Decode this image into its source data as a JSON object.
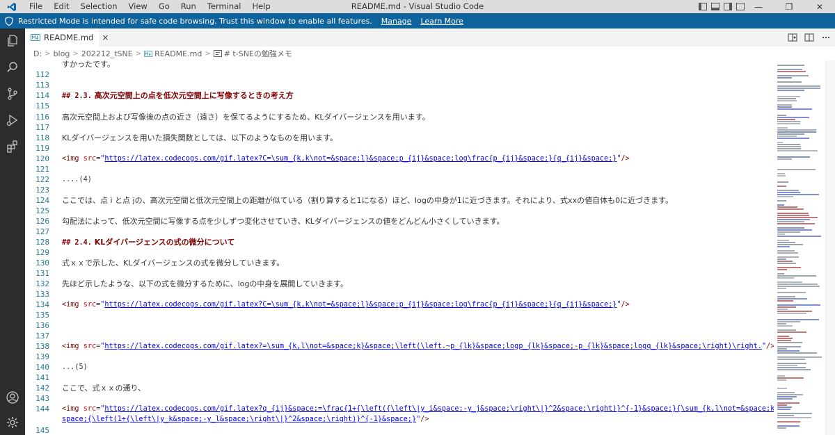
{
  "window": {
    "title": "README.md - Visual Studio Code",
    "menu": [
      "File",
      "Edit",
      "Selection",
      "View",
      "Go",
      "Run",
      "Terminal",
      "Help"
    ],
    "controls": {
      "minimize": "—",
      "restore": "❐",
      "close": "✕"
    }
  },
  "banner": {
    "message": "Restricted Mode is intended for safe code browsing. Trust this window to enable all features.",
    "manage": "Manage",
    "learn_more": "Learn More",
    "color": "#0e639c"
  },
  "activity_bar": {
    "items": [
      {
        "name": "explorer-icon"
      },
      {
        "name": "search-icon"
      },
      {
        "name": "source-control-icon"
      },
      {
        "name": "run-debug-icon"
      },
      {
        "name": "extensions-icon"
      },
      {
        "name": "accounts-icon"
      },
      {
        "name": "manage-gear-icon"
      }
    ]
  },
  "tab": {
    "label": "README.md",
    "close": "×"
  },
  "breadcrumb": {
    "parts": [
      "D:",
      "blog",
      "202212_tSNE",
      "README.md",
      "# t-SNEの勉強メモ"
    ]
  },
  "editor": {
    "top_partial": "すかったです。",
    "lines": {
      "n112": "112",
      "n113": "113",
      "n114": "114",
      "n115": "115",
      "n116": "116",
      "n117": "117",
      "n118": "118",
      "n119": "119",
      "n120": "120",
      "n121": "121",
      "n122": "122",
      "n123": "123",
      "n124": "124",
      "n125": "125",
      "n126": "126",
      "n127": "127",
      "n128": "128",
      "n129": "129",
      "n130": "130",
      "n131": "131",
      "n132": "132",
      "n133": "133",
      "n134": "134",
      "n135": "135",
      "n136": "136",
      "n137": "137",
      "n138": "138",
      "n139": "139",
      "n140": "140",
      "n141": "141",
      "n142": "142",
      "n143": "143",
      "n144": "144",
      "n145": "145"
    },
    "l114_mark": "## 2.3.",
    "l114_text": "高次元空間上の点を低次元空間上に写像するときの考え方",
    "l116": "高次元空間上および写像後の点の近さ（遠さ）を保てるようにするため、KLダイバージェンスを用います。",
    "l118": "KLダイバージェンスを用いた損失関数としては、以下のようなものを用います。",
    "img_open": "<img",
    "src_attr": "src",
    "eq": "=",
    "quote": "\"",
    "img_close": "/>",
    "url_120": "https://latex.codecogs.com/gif.latex?C=\\sum_{k,k\\not=&space;l}&space;p_{ij}&space;log\\frac{p_{ij}&space;}{q_{ij}&space;}",
    "l122": "....(4)",
    "l124": "ここでは、点 i と点 jの、高次元空間と低次元空間上の距離が似ている（割り算すると1になる）ほど、logの中身が1に近づきます。それにより、式xxの値自体も0に近づきます。",
    "l126": "勾配法によって、低次元空間に写像する点を少しずつ変化させていき、KLダイバージェンスの値をどんどん小さくしていきます。",
    "l128_mark": "## 2.4.",
    "l128_text": "KLダイバージェンスの式の微分について",
    "l130": "式ｘｘで示した、KLダイバージェンスの式を微分していきます。",
    "l132": "先ほど示したような、以下の式を微分するために、logの中身を展開していきます。",
    "url_134": "https://latex.codecogs.com/gif.latex?C=\\sum_{k,k\\not=&space;l}&space;p_{ij}&space;log\\frac{p_{ij}&space;}{q_{ij}&space;}",
    "url_138": "https://latex.codecogs.com/gif.latex?=\\sum_{k,l\\not=&space;k}&space;\\left(\\left.~p_{lk}&space;logp_{lk}&space;-p_{lk}&space;logq_{lk}&space;\\right)\\right.",
    "l140": "...(5)",
    "l142": "ここで、式ｘｘの通り、",
    "url_144a": "https://latex.codecogs.com/gif.latex?q_{ij}&space;=\\frac{1+{\\left({\\left\\|y_i&space;-y_j&space;\\right\\|}^2&space;\\right)}^{-1}&space;}{\\sum_{k,l\\not=&space;k}&",
    "url_144b": "space;{\\left(1+{\\left\\|y_k&space;-y_l&space;\\right\\|}^2&space;\\right)}^{-1}&space;}",
    "colors": {
      "line_number": "#237893",
      "heading": "#800000",
      "tag": "#800000",
      "attribute": "#e50000",
      "string": "#0000ff"
    }
  }
}
